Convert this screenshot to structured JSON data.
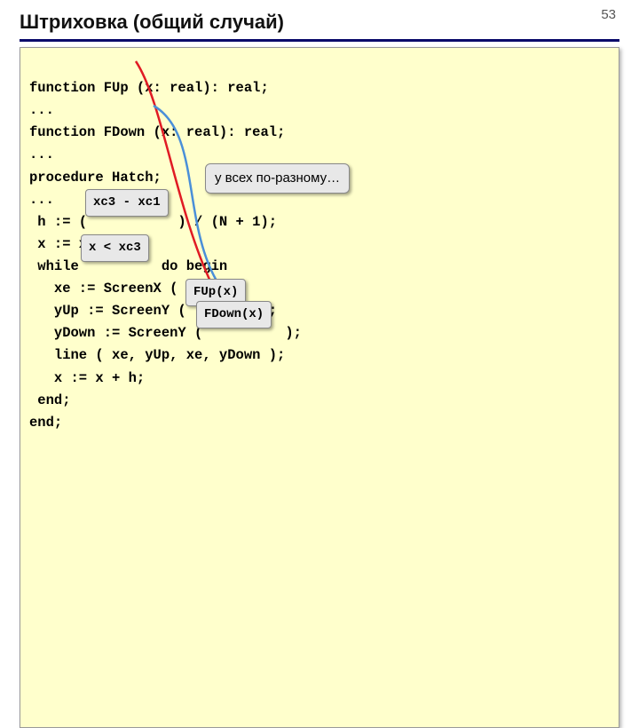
{
  "page_number": "53",
  "title": "Штриховка (общий случай)",
  "code": {
    "l1": "function FUp (x: real): real;",
    "l2": "...",
    "l3": "function FDown (x: real): real;",
    "l4": "...",
    "l5": "procedure Hatch;",
    "l6": "...",
    "l7": " h := (           ) / (N + 1);",
    "l8": " x := xc1 + h;",
    "l9": " while          do begin",
    "l10": "   xe := ScreenX ( x );",
    "l11": "   yUp := ScreenY (         );",
    "l12": "   yDown := ScreenY (          );",
    "l13": "   line ( xe, yUp, xe, yDown );",
    "l14": "   x := x + h;",
    "l15": " end;",
    "l16": "end;"
  },
  "callout": "у всех по-разному…",
  "badges": {
    "diff": "xc3 - xc1",
    "cond": "x < xc3",
    "fup": "FUp(x)",
    "fdown": "FDown(x)"
  },
  "colors": {
    "red": "#e01b24",
    "blue": "#4a8fd8"
  }
}
